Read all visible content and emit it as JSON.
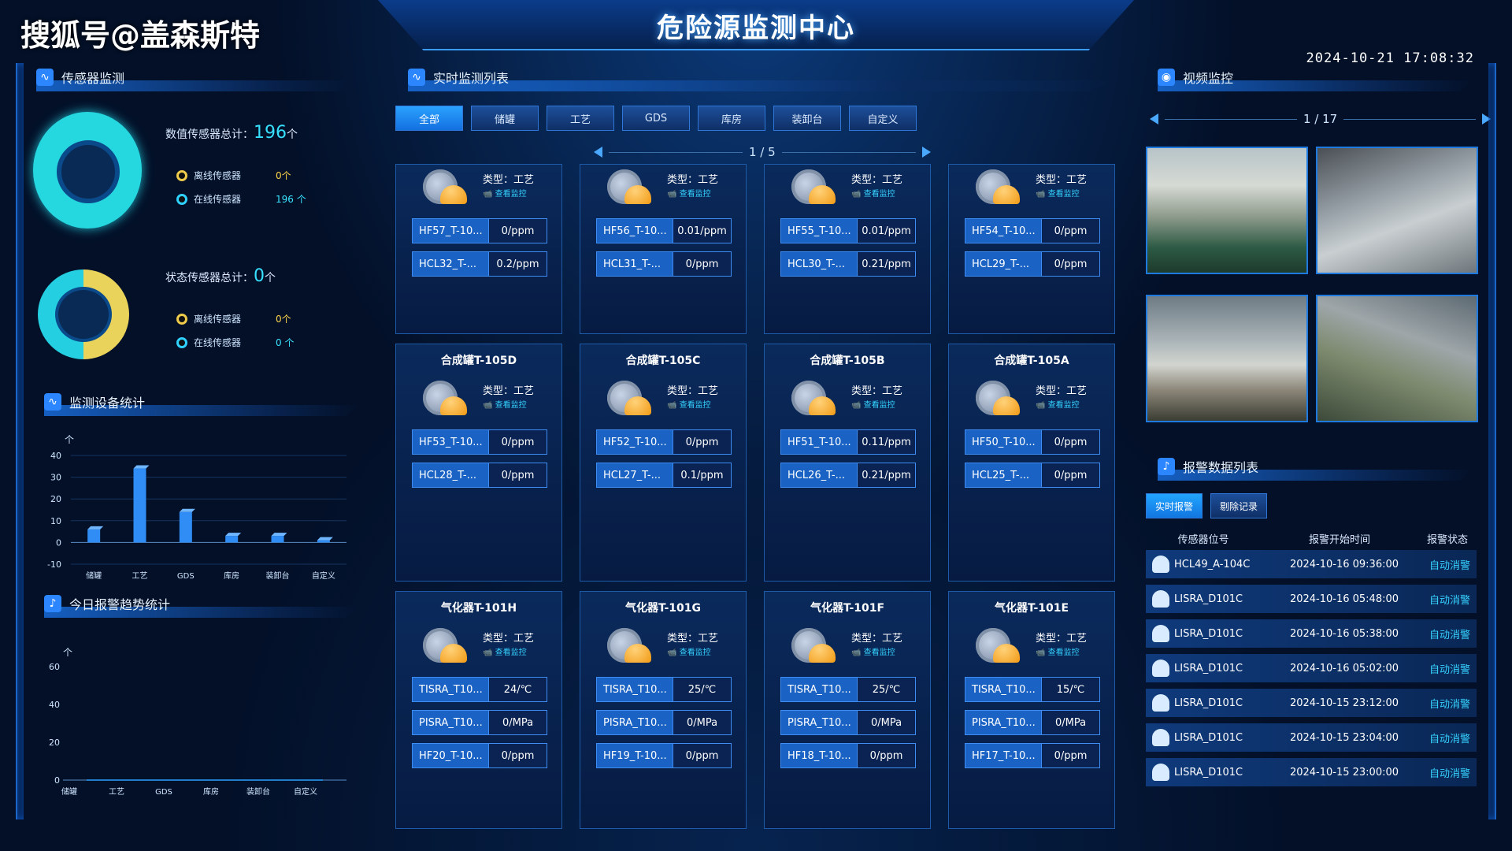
{
  "header": {
    "title": "危险源监测中心",
    "watermark": "搜狐号@盖森斯特",
    "datetime": "2024-10-21 17:08:32"
  },
  "sensor_section": {
    "title": "传感器监测",
    "numeric": {
      "label": "数值传感器总计：",
      "total": "196",
      "unit": "个",
      "offline_label": "离线传感器",
      "offline_value": "0个",
      "online_label": "在线传感器",
      "online_value": "196 个"
    },
    "status": {
      "label": "状态传感器总计：",
      "total": "0",
      "unit": "个",
      "offline_label": "离线传感器",
      "offline_value": "0个",
      "online_label": "在线传感器",
      "online_value": "0 个"
    }
  },
  "device_stats": {
    "title": "监测设备统计",
    "y_unit": "个"
  },
  "alarm_trend": {
    "title": "今日报警趋势统计",
    "y_unit": "个"
  },
  "realtime": {
    "title": "实时监测列表",
    "tabs": [
      "全部",
      "储罐",
      "工艺",
      "GDS",
      "库房",
      "装卸台",
      "自定义"
    ],
    "pager": "1 / 5",
    "type_text": "类型：工艺",
    "view_link": "查看监控",
    "cards": [
      {
        "title": "",
        "rows": [
          {
            "name": "HF57_T-10...",
            "value": "0/ppm"
          },
          {
            "name": "HCL32_T-...",
            "value": "0.2/ppm"
          }
        ]
      },
      {
        "title": "",
        "rows": [
          {
            "name": "HF56_T-10...",
            "value": "0.01/ppm"
          },
          {
            "name": "HCL31_T-...",
            "value": "0/ppm"
          }
        ]
      },
      {
        "title": "",
        "rows": [
          {
            "name": "HF55_T-10...",
            "value": "0.01/ppm"
          },
          {
            "name": "HCL30_T-...",
            "value": "0.21/ppm"
          }
        ]
      },
      {
        "title": "",
        "rows": [
          {
            "name": "HF54_T-10...",
            "value": "0/ppm"
          },
          {
            "name": "HCL29_T-...",
            "value": "0/ppm"
          }
        ]
      },
      {
        "title": "合成罐T-105D",
        "rows": [
          {
            "name": "HF53_T-10...",
            "value": "0/ppm"
          },
          {
            "name": "HCL28_T-...",
            "value": "0/ppm"
          }
        ]
      },
      {
        "title": "合成罐T-105C",
        "rows": [
          {
            "name": "HF52_T-10...",
            "value": "0/ppm"
          },
          {
            "name": "HCL27_T-...",
            "value": "0.1/ppm"
          }
        ]
      },
      {
        "title": "合成罐T-105B",
        "rows": [
          {
            "name": "HF51_T-10...",
            "value": "0.11/ppm"
          },
          {
            "name": "HCL26_T-...",
            "value": "0.21/ppm"
          }
        ]
      },
      {
        "title": "合成罐T-105A",
        "rows": [
          {
            "name": "HF50_T-10...",
            "value": "0/ppm"
          },
          {
            "name": "HCL25_T-...",
            "value": "0/ppm"
          }
        ]
      },
      {
        "title": "气化器T-101H",
        "rows": [
          {
            "name": "TISRA_T10...",
            "value": "24/℃"
          },
          {
            "name": "PISRA_T10...",
            "value": "0/MPa"
          },
          {
            "name": "HF20_T-10...",
            "value": "0/ppm"
          }
        ]
      },
      {
        "title": "气化器T-101G",
        "rows": [
          {
            "name": "TISRA_T10...",
            "value": "25/℃"
          },
          {
            "name": "PISRA_T10...",
            "value": "0/MPa"
          },
          {
            "name": "HF19_T-10...",
            "value": "0/ppm"
          }
        ]
      },
      {
        "title": "气化器T-101F",
        "rows": [
          {
            "name": "TISRA_T10...",
            "value": "25/℃"
          },
          {
            "name": "PISRA_T10...",
            "value": "0/MPa"
          },
          {
            "name": "HF18_T-10...",
            "value": "0/ppm"
          }
        ]
      },
      {
        "title": "气化器T-101E",
        "rows": [
          {
            "name": "TISRA_T10...",
            "value": "15/℃"
          },
          {
            "name": "PISRA_T10...",
            "value": "0/MPa"
          },
          {
            "name": "HF17_T-10...",
            "value": "0/ppm"
          }
        ]
      }
    ]
  },
  "video": {
    "title": "视频监控",
    "pager": "1 / 17"
  },
  "alarm": {
    "title": "报警数据列表",
    "tabs": [
      "实时报警",
      "剔除记录"
    ],
    "headers": [
      "传感器位号",
      "报警开始时间",
      "报警状态"
    ],
    "rows": [
      {
        "tag": "HCL49_A-104C",
        "time": "2024-10-16 09:36:00",
        "status": "自动消警"
      },
      {
        "tag": "LISRA_D101C",
        "time": "2024-10-16 05:48:00",
        "status": "自动消警"
      },
      {
        "tag": "LISRA_D101C",
        "time": "2024-10-16 05:38:00",
        "status": "自动消警"
      },
      {
        "tag": "LISRA_D101C",
        "time": "2024-10-16 05:02:00",
        "status": "自动消警"
      },
      {
        "tag": "LISRA_D101C",
        "time": "2024-10-15 23:12:00",
        "status": "自动消警"
      },
      {
        "tag": "LISRA_D101C",
        "time": "2024-10-15 23:04:00",
        "status": "自动消警"
      },
      {
        "tag": "LISRA_D101C",
        "time": "2024-10-15 23:00:00",
        "status": "自动消警"
      }
    ]
  },
  "chart_data": [
    {
      "type": "bar",
      "categories": [
        "储罐",
        "工艺",
        "GDS",
        "库房",
        "装卸台",
        "自定义"
      ],
      "values": [
        6,
        34,
        14,
        3,
        3,
        1
      ],
      "ylabel": "个",
      "ylim": [
        -10,
        40
      ],
      "yticks": [
        -10,
        0,
        10,
        20,
        30,
        40
      ]
    },
    {
      "type": "line",
      "categories": [
        "储罐",
        "工艺",
        "GDS",
        "库房",
        "装卸台",
        "自定义"
      ],
      "values": [
        0,
        0,
        0,
        0,
        0,
        0
      ],
      "ylabel": "个",
      "ylim": [
        0,
        60
      ],
      "yticks": [
        0,
        20,
        40,
        60
      ]
    }
  ],
  "colors": {
    "accent": "#2aa2ff",
    "cyan": "#35d2ff",
    "yellow": "#eecb4a",
    "background": "#031028"
  }
}
